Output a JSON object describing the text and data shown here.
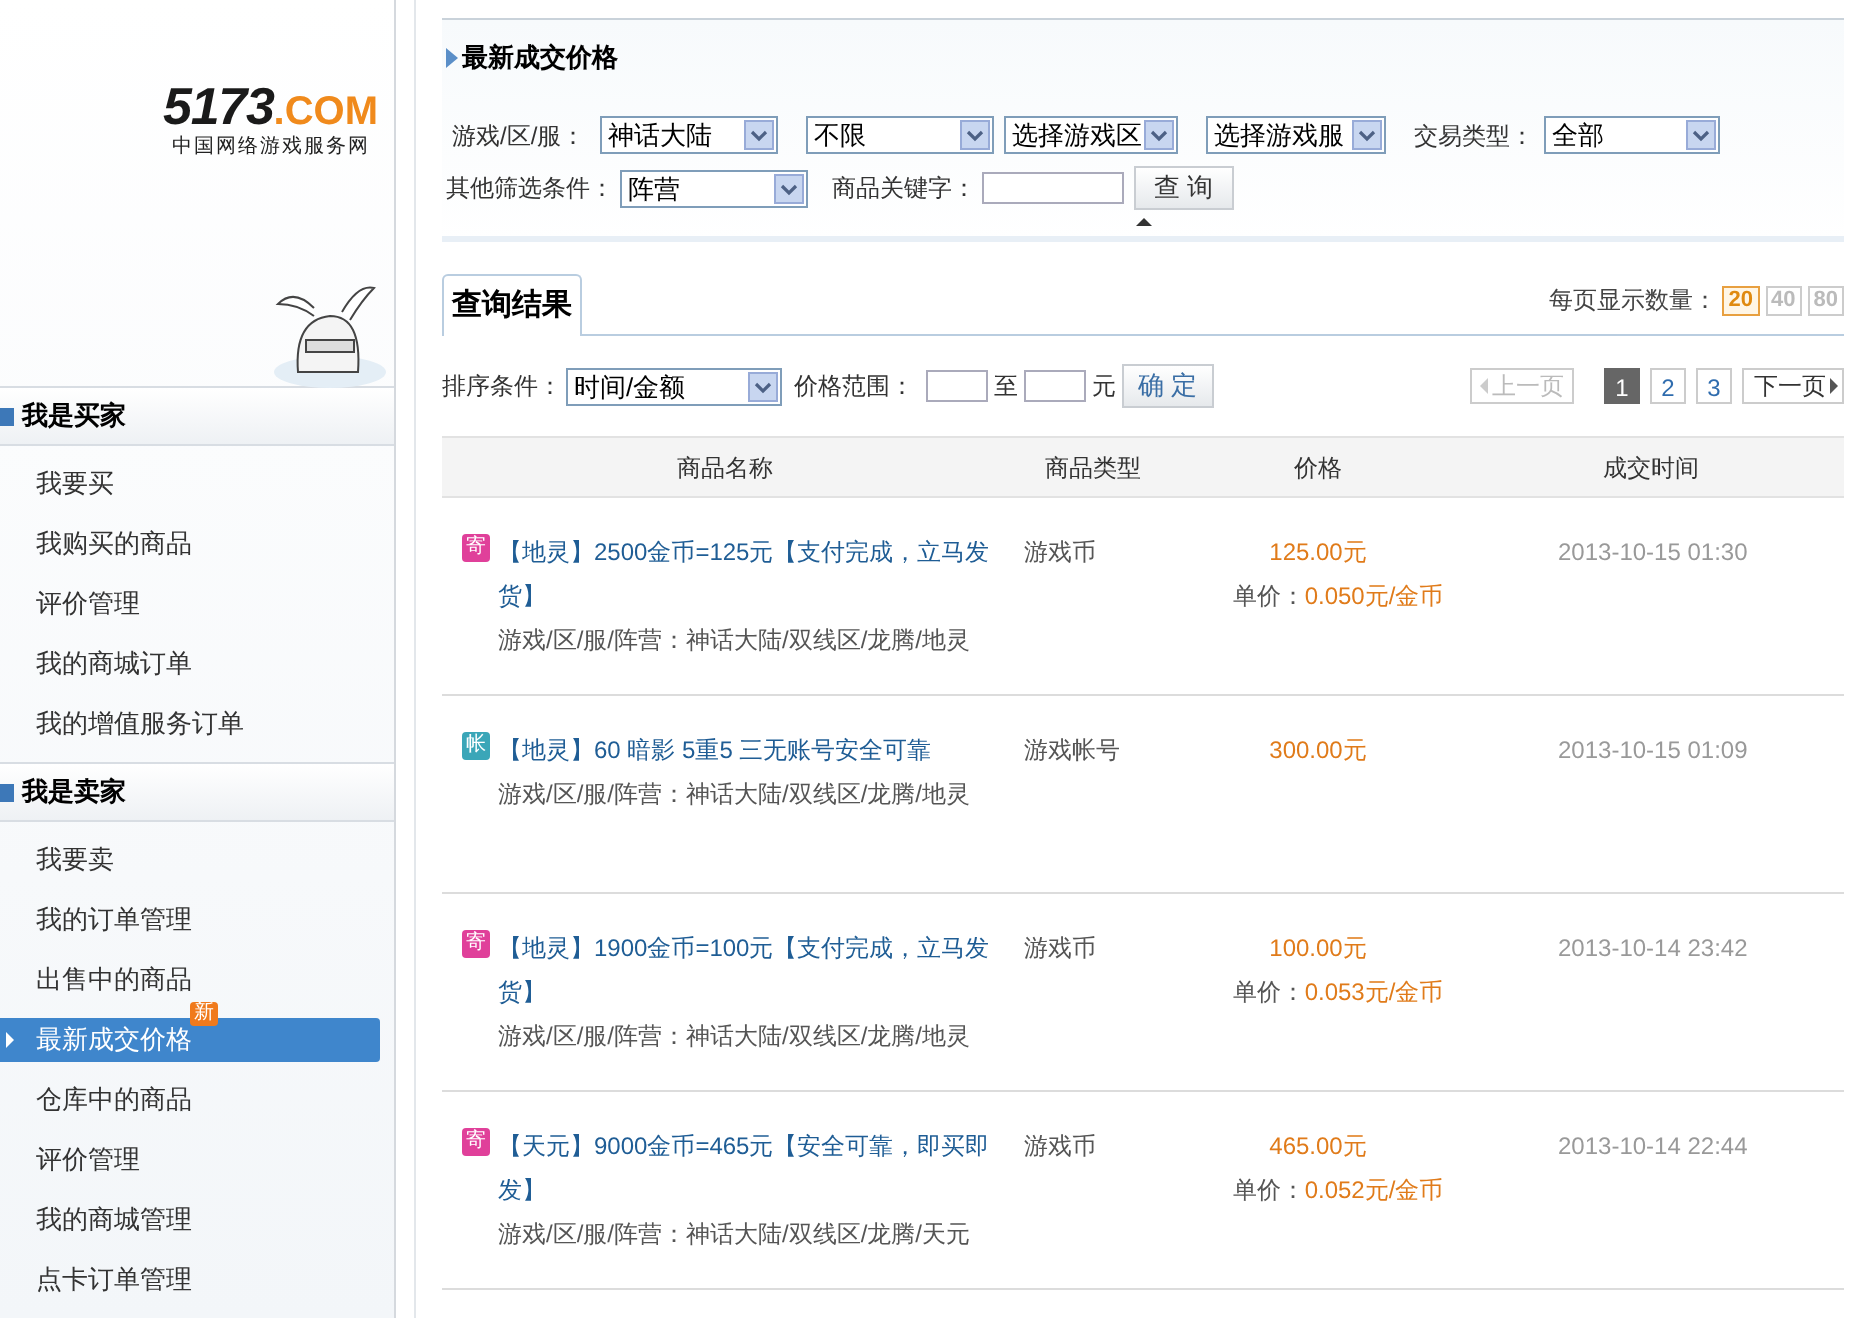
{
  "logo": {
    "brand_number": "5173",
    "brand_domain": ".COM",
    "tagline": "中国网络游戏服务网"
  },
  "sidebar": {
    "sections": [
      {
        "title": "我是买家",
        "items": [
          {
            "label": "我要买",
            "selected": false
          },
          {
            "label": "我购买的商品",
            "selected": false
          },
          {
            "label": "评价管理",
            "selected": false
          },
          {
            "label": "我的商城订单",
            "selected": false
          },
          {
            "label": "我的增值服务订单",
            "selected": false
          }
        ]
      },
      {
        "title": "我是卖家",
        "items": [
          {
            "label": "我要卖",
            "selected": false
          },
          {
            "label": "我的订单管理",
            "selected": false
          },
          {
            "label": "出售中的商品",
            "selected": false
          },
          {
            "label": "最新成交价格",
            "selected": true,
            "badge": "新"
          },
          {
            "label": "仓库中的商品",
            "selected": false
          },
          {
            "label": "评价管理",
            "selected": false
          },
          {
            "label": "我的商城管理",
            "selected": false
          },
          {
            "label": "点卡订单管理",
            "selected": false
          }
        ]
      }
    ]
  },
  "main": {
    "title": "最新成交价格",
    "filters": {
      "game_label": "游戏/区/服：",
      "game_selects": [
        "神话大陆",
        "不限",
        "选择游戏区",
        "选择游戏服"
      ],
      "trade_type_label": "交易类型：",
      "trade_type": "全部",
      "other_label": "其他筛选条件：",
      "other": "阵营",
      "keyword_label": "商品关键字：",
      "search_button": "查 询"
    },
    "results_tab": "查询结果",
    "per_page_label": "每页显示数量：",
    "per_page": [
      {
        "label": "20",
        "selected": true
      },
      {
        "label": "40",
        "selected": false
      },
      {
        "label": "80",
        "selected": false
      }
    ],
    "sort": {
      "label": "排序条件：",
      "value": "时间/金额",
      "range_label": "价格范围：",
      "to": "至",
      "unit": "元",
      "confirm_button": "确 定"
    },
    "pagination": {
      "prev": {
        "label": "上一页",
        "disabled": true
      },
      "pages": [
        {
          "label": "1",
          "selected": true
        },
        {
          "label": "2",
          "selected": false
        },
        {
          "label": "3",
          "selected": false
        }
      ],
      "next": {
        "label": "下一页",
        "disabled": false
      }
    },
    "columns": [
      "商品名称",
      "商品类型",
      "价格",
      "成交时间"
    ],
    "rows": [
      {
        "tag": "寄",
        "color": "#e0409a",
        "title": "【地灵】2500金币=125元【支付完成，立马发货】",
        "location": "游戏/区/服/阵营：神话大陆/双线区/龙腾/地灵",
        "type": "游戏币",
        "price": "125.00元",
        "unit_price_label": "单价：",
        "unit_price": "0.050元/金币",
        "time": "2013-10-15 01:30"
      },
      {
        "tag": "帐",
        "color": "#3aa6b8",
        "title": "【地灵】60 暗影 5重5 三无账号安全可靠",
        "location": "游戏/区/服/阵营：神话大陆/双线区/龙腾/地灵",
        "type": "游戏帐号",
        "price": "300.00元",
        "time": "2013-10-15 01:09"
      },
      {
        "tag": "寄",
        "color": "#e0409a",
        "title": "【地灵】1900金币=100元【支付完成，立马发货】",
        "location": "游戏/区/服/阵营：神话大陆/双线区/龙腾/地灵",
        "type": "游戏币",
        "price": "100.00元",
        "unit_price_label": "单价：",
        "unit_price": "0.053元/金币",
        "time": "2013-10-14 23:42"
      },
      {
        "tag": "寄",
        "color": "#e0409a",
        "title": "【天元】9000金币=465元【安全可靠，即买即发】",
        "location": "游戏/区/服/阵营：神话大陆/双线区/龙腾/天元",
        "type": "游戏币",
        "price": "465.00元",
        "unit_price_label": "单价：",
        "unit_price": "0.052元/金币",
        "time": "2013-10-14 22:44"
      }
    ]
  }
}
